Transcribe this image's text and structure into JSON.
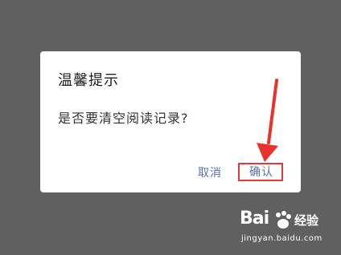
{
  "dialog": {
    "title": "温馨提示",
    "message": "是否要清空阅读记录?",
    "cancel_label": "取消",
    "confirm_label": "确认"
  },
  "annotation": {
    "arrow_color": "#e8322e",
    "highlight_color": "#e03a3a"
  },
  "watermark": {
    "logo_text": "Bai",
    "brand": "经验",
    "url": "jingyan.baidu.com"
  },
  "colors": {
    "backdrop": "#606060",
    "button_text": "#5a6fb0"
  }
}
